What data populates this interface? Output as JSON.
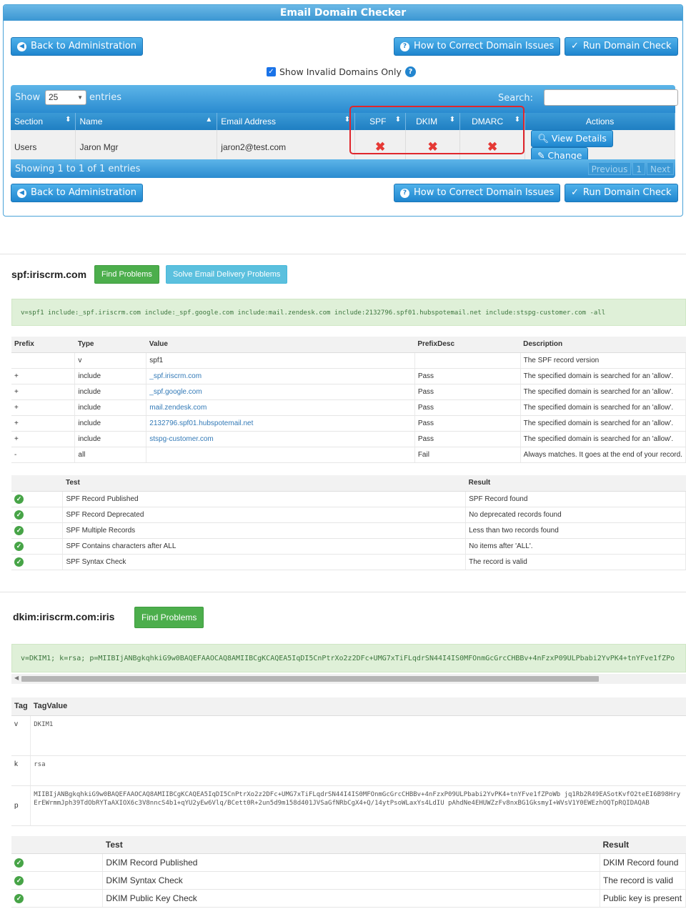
{
  "checker": {
    "title": "Email Domain Checker",
    "back_label": "Back to Administration",
    "howto_label": "How to Correct Domain Issues",
    "run_label": "Run Domain Check",
    "invalid_only_label": "Show Invalid Domains Only",
    "show_label": "Show",
    "entries_label": "entries",
    "length_value": "25",
    "search_label": "Search:",
    "columns": [
      "Section",
      "Name",
      "Email Address",
      "SPF",
      "DKIM",
      "DMARC",
      "Actions"
    ],
    "rows": [
      {
        "section": "Users",
        "name": "Jaron Mgr",
        "email": "jaron2@test.com",
        "spf": "✖",
        "dkim": "✖",
        "dmarc": "✖"
      }
    ],
    "view_label": "View Details",
    "change_label": "Change",
    "info": "Showing 1 to 1 of 1 entries",
    "pager": {
      "previous": "Previous",
      "page": "1",
      "next": "Next"
    }
  },
  "spf": {
    "title": "spf:iriscrm.com",
    "find_label": "Find Problems",
    "solve_label": "Solve Email Delivery Problems",
    "record": "v=spf1 include:_spf.iriscrm.com include:_spf.google.com include:mail.zendesk.com include:2132796.spf01.hubspotemail.net include:stspg-customer.com -all",
    "columns": [
      "Prefix",
      "Type",
      "Value",
      "PrefixDesc",
      "Description"
    ],
    "rows": [
      {
        "prefix": "",
        "type": "v",
        "value": "spf1",
        "desc": "",
        "description": "The SPF record version"
      },
      {
        "prefix": "+",
        "type": "include",
        "value": "_spf.iriscrm.com",
        "desc": "Pass",
        "description": "The specified domain is searched for an 'allow'."
      },
      {
        "prefix": "+",
        "type": "include",
        "value": "_spf.google.com",
        "desc": "Pass",
        "description": "The specified domain is searched for an 'allow'."
      },
      {
        "prefix": "+",
        "type": "include",
        "value": "mail.zendesk.com",
        "desc": "Pass",
        "description": "The specified domain is searched for an 'allow'."
      },
      {
        "prefix": "+",
        "type": "include",
        "value": "2132796.spf01.hubspotemail.net",
        "desc": "Pass",
        "description": "The specified domain is searched for an 'allow'."
      },
      {
        "prefix": "+",
        "type": "include",
        "value": "stspg-customer.com",
        "desc": "Pass",
        "description": "The specified domain is searched for an 'allow'."
      },
      {
        "prefix": "-",
        "type": "all",
        "value": "",
        "desc": "Fail",
        "description": "Always matches. It goes at the end of your record."
      }
    ],
    "test_columns": [
      "Test",
      "Result"
    ],
    "tests": [
      {
        "test": "SPF Record Published",
        "result": "SPF Record found"
      },
      {
        "test": "SPF Record Deprecated",
        "result": "No deprecated records found"
      },
      {
        "test": "SPF Multiple Records",
        "result": "Less than two records found"
      },
      {
        "test": "SPF Contains characters after ALL",
        "result": "No items after 'ALL'."
      },
      {
        "test": "SPF Syntax Check",
        "result": "The record is valid"
      }
    ]
  },
  "dkim": {
    "title": "dkim:iriscrm.com:iris",
    "find_label": "Find Problems",
    "record": "v=DKIM1; k=rsa; p=MIIBIjANBgkqhkiG9w0BAQEFAAOCAQ8AMIIBCgKCAQEA5IqDI5CnPtrXo2z2DFc+UMG7xTiFLqdrSN44I4IS0MFOnmGcGrcCHBBv+4nFzxP09ULPbabi2YvPK4+tnYFve1fZPo",
    "tag_columns": [
      "Tag",
      "TagValue"
    ],
    "tags": [
      {
        "tag": "v",
        "value": "DKIM1"
      },
      {
        "tag": "k",
        "value": "rsa"
      },
      {
        "tag": "p",
        "value": "MIIBIjANBgkqhkiG9w0BAQEFAAOCAQ8AMIIBCgKCAQEA5IqDI5CnPtrXo2z2DFc+UMG7xTiFLqdrSN44I4IS0MFOnmGcGrcCHBBv+4nFzxP09ULPbabi2YvPK4+tnYFve1fZPoWb jq1Rb2R49EASotKvfO2teEI6B98HryErEWrmmJph39TdObRYTaAXIOX6c3V8nncS4b1+qYU2yEw6Vlq/BCett0R+2un5d9m158d401JVSaGfNRbCgX4+Q/14ytPsoWLaxYs4LdIU pAhdNe4EHUWZzFv8nxBG1GksmyI+WVsV1Y0EWEzhOQTpRQIDAQAB"
      }
    ],
    "test_columns": [
      "Test",
      "Result"
    ],
    "tests": [
      {
        "test": "DKIM Record Published",
        "result": "DKIM Record found"
      },
      {
        "test": "DKIM Syntax Check",
        "result": "The record is valid"
      },
      {
        "test": "DKIM Public Key Check",
        "result": "Public key is present"
      }
    ]
  }
}
